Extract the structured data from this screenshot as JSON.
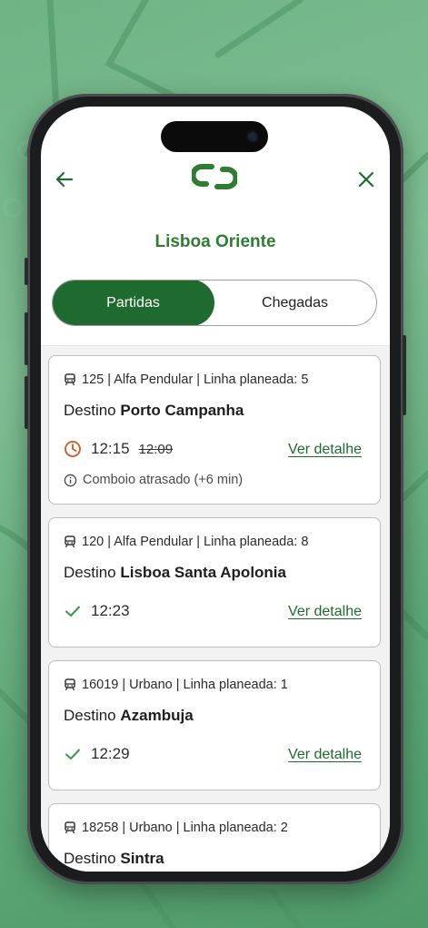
{
  "header": {
    "station": "Lisboa Oriente",
    "back_icon": "arrow-left-icon",
    "close_icon": "close-icon",
    "logo": "cp-logo"
  },
  "tabs": [
    {
      "label": "Partidas",
      "active": true
    },
    {
      "label": "Chegadas",
      "active": false
    }
  ],
  "trains": [
    {
      "meta": "125 | Alfa Pendular | Linha planeada:  5",
      "dest_prefix": "Destino",
      "dest_name": "Porto Campanha",
      "time": "12:15",
      "old_time": "12:09",
      "status": "Comboio atrasado (+6 min)",
      "link": "Ver detalhe",
      "state": "delayed"
    },
    {
      "meta": "120 | Alfa Pendular | Linha planeada:  8",
      "dest_prefix": "Destino",
      "dest_name": "Lisboa Santa Apolonia",
      "time": "12:23",
      "link": "Ver detalhe",
      "state": "on-time"
    },
    {
      "meta": "16019 | Urbano | Linha planeada:  1",
      "dest_prefix": "Destino",
      "dest_name": "Azambuja",
      "time": "12:29",
      "link": "Ver detalhe",
      "state": "on-time"
    },
    {
      "meta": "18258 | Urbano | Linha planeada:  2",
      "dest_prefix": "Destino",
      "dest_name": "Sintra"
    }
  ],
  "colors": {
    "brand_green": "#1e6a2f",
    "title_green": "#2e7d32",
    "delay_orange": "#d1571f",
    "ok_green": "#3a9a4c"
  }
}
